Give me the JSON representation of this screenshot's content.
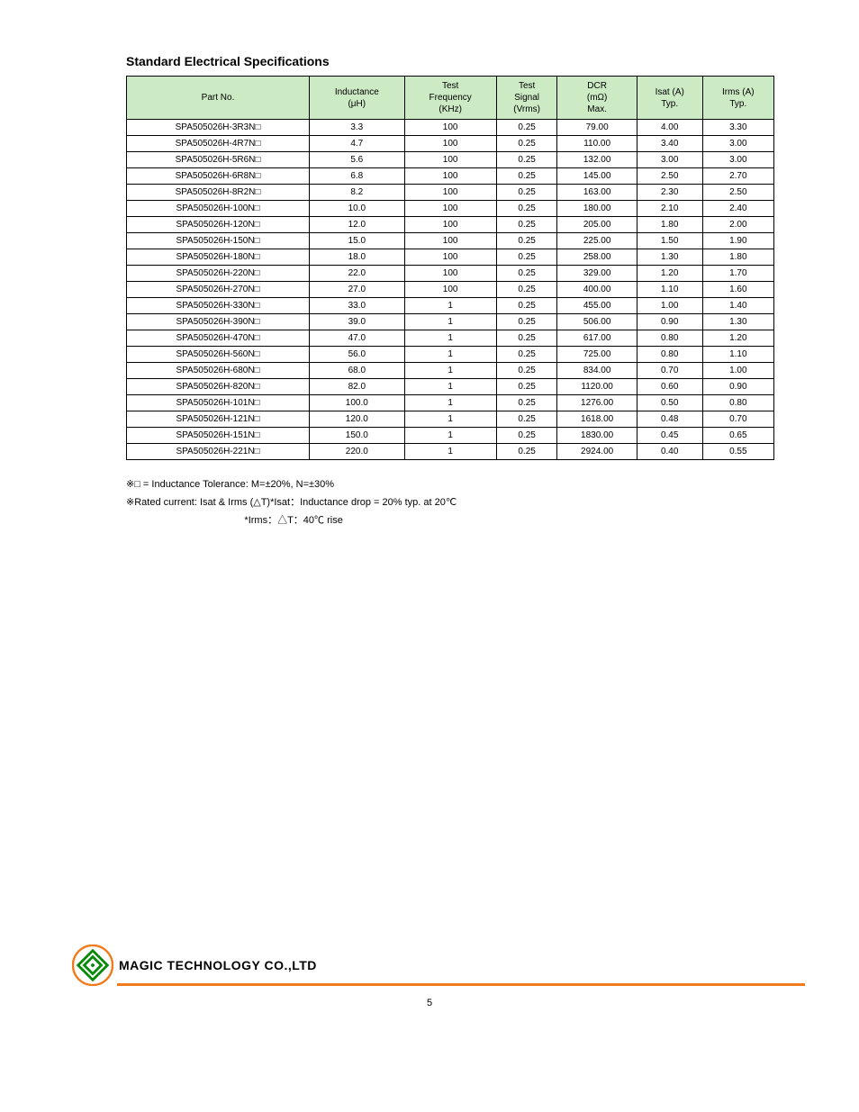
{
  "section_title": "Standard Electrical Specifications",
  "headers": {
    "h0": "Part No.",
    "h1a": "Inductance",
    "h1b": "(μH)",
    "h2a": "Test",
    "h2b": "Frequency",
    "h2c": "(KHz)",
    "h3a": "Test",
    "h3b": "Signal",
    "h3c": "(Vrms)",
    "h4a": "DCR",
    "h4b": "(mΩ)",
    "h4c": "Max.",
    "h5a": "Isat (A)",
    "h5b": "Typ.",
    "h6a": "Irms (A)",
    "h6b": "Typ."
  },
  "rows": [
    {
      "pn": "SPA505026H-3R3N□",
      "ind": "3.3",
      "freq": "100",
      "sig": "0.25",
      "dcr": "79.00",
      "isat": "4.00",
      "irms": "3.30"
    },
    {
      "pn": "SPA505026H-4R7N□",
      "ind": "4.7",
      "freq": "100",
      "sig": "0.25",
      "dcr": "110.00",
      "isat": "3.40",
      "irms": "3.00"
    },
    {
      "pn": "SPA505026H-5R6N□",
      "ind": "5.6",
      "freq": "100",
      "sig": "0.25",
      "dcr": "132.00",
      "isat": "3.00",
      "irms": "3.00"
    },
    {
      "pn": "SPA505026H-6R8N□",
      "ind": "6.8",
      "freq": "100",
      "sig": "0.25",
      "dcr": "145.00",
      "isat": "2.50",
      "irms": "2.70"
    },
    {
      "pn": "SPA505026H-8R2N□",
      "ind": "8.2",
      "freq": "100",
      "sig": "0.25",
      "dcr": "163.00",
      "isat": "2.30",
      "irms": "2.50"
    },
    {
      "pn": "SPA505026H-100N□",
      "ind": "10.0",
      "freq": "100",
      "sig": "0.25",
      "dcr": "180.00",
      "isat": "2.10",
      "irms": "2.40"
    },
    {
      "pn": "SPA505026H-120N□",
      "ind": "12.0",
      "freq": "100",
      "sig": "0.25",
      "dcr": "205.00",
      "isat": "1.80",
      "irms": "2.00"
    },
    {
      "pn": "SPA505026H-150N□",
      "ind": "15.0",
      "freq": "100",
      "sig": "0.25",
      "dcr": "225.00",
      "isat": "1.50",
      "irms": "1.90"
    },
    {
      "pn": "SPA505026H-180N□",
      "ind": "18.0",
      "freq": "100",
      "sig": "0.25",
      "dcr": "258.00",
      "isat": "1.30",
      "irms": "1.80"
    },
    {
      "pn": "SPA505026H-220N□",
      "ind": "22.0",
      "freq": "100",
      "sig": "0.25",
      "dcr": "329.00",
      "isat": "1.20",
      "irms": "1.70"
    },
    {
      "pn": "SPA505026H-270N□",
      "ind": "27.0",
      "freq": "100",
      "sig": "0.25",
      "dcr": "400.00",
      "isat": "1.10",
      "irms": "1.60"
    },
    {
      "pn": "SPA505026H-330N□",
      "ind": "33.0",
      "freq": "1",
      "sig": "0.25",
      "dcr": "455.00",
      "isat": "1.00",
      "irms": "1.40"
    },
    {
      "pn": "SPA505026H-390N□",
      "ind": "39.0",
      "freq": "1",
      "sig": "0.25",
      "dcr": "506.00",
      "isat": "0.90",
      "irms": "1.30"
    },
    {
      "pn": "SPA505026H-470N□",
      "ind": "47.0",
      "freq": "1",
      "sig": "0.25",
      "dcr": "617.00",
      "isat": "0.80",
      "irms": "1.20"
    },
    {
      "pn": "SPA505026H-560N□",
      "ind": "56.0",
      "freq": "1",
      "sig": "0.25",
      "dcr": "725.00",
      "isat": "0.80",
      "irms": "1.10"
    },
    {
      "pn": "SPA505026H-680N□",
      "ind": "68.0",
      "freq": "1",
      "sig": "0.25",
      "dcr": "834.00",
      "isat": "0.70",
      "irms": "1.00"
    },
    {
      "pn": "SPA505026H-820N□",
      "ind": "82.0",
      "freq": "1",
      "sig": "0.25",
      "dcr": "1120.00",
      "isat": "0.60",
      "irms": "0.90"
    },
    {
      "pn": "SPA505026H-101N□",
      "ind": "100.0",
      "freq": "1",
      "sig": "0.25",
      "dcr": "1276.00",
      "isat": "0.50",
      "irms": "0.80"
    },
    {
      "pn": "SPA505026H-121N□",
      "ind": "120.0",
      "freq": "1",
      "sig": "0.25",
      "dcr": "1618.00",
      "isat": "0.48",
      "irms": "0.70"
    },
    {
      "pn": "SPA505026H-151N□",
      "ind": "150.0",
      "freq": "1",
      "sig": "0.25",
      "dcr": "1830.00",
      "isat": "0.45",
      "irms": "0.65"
    },
    {
      "pn": "SPA505026H-221N□",
      "ind": "220.0",
      "freq": "1",
      "sig": "0.25",
      "dcr": "2924.00",
      "isat": "0.40",
      "irms": "0.55"
    }
  ],
  "notes": {
    "line1": "※□ = Inductance Tolerance: M=±20%, N=±30%",
    "line2": "※Rated current: Isat & Irms (△T)*Isat：Inductance drop = 20% typ. at 20℃",
    "line3": "                                           *Irms：△T：40℃ rise"
  },
  "company": "MAGIC TECHNOLOGY CO.,LTD",
  "page_no": "5"
}
